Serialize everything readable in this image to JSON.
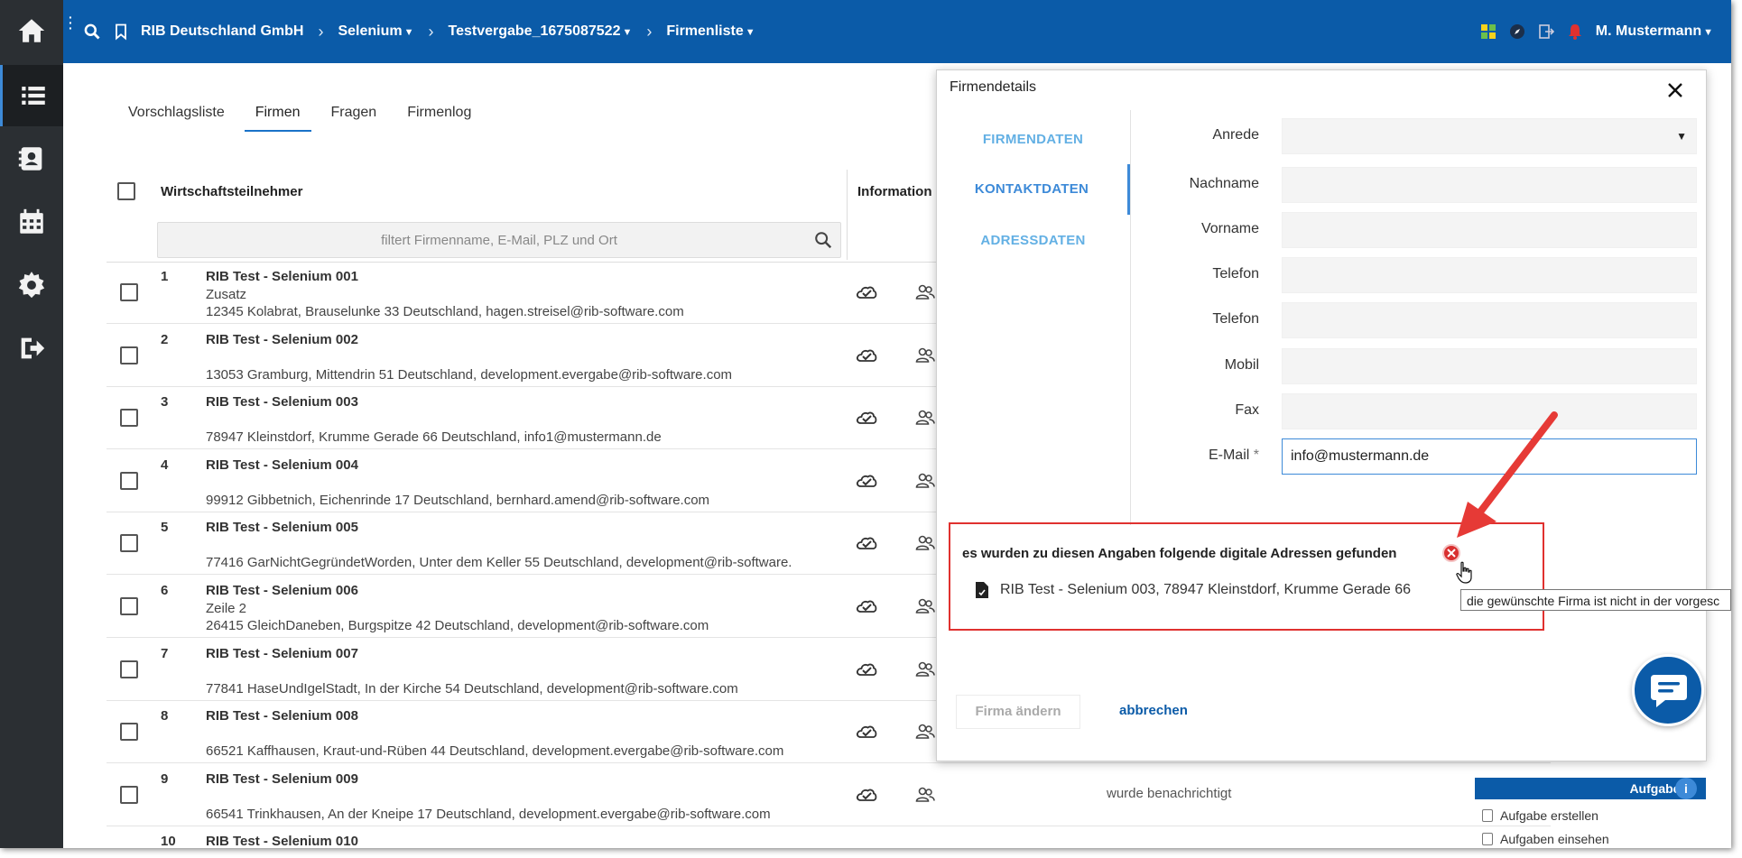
{
  "header": {
    "org": "RIB Deutschland GmbH",
    "crumbs": [
      "Selenium",
      "Testvergabe_1675087522",
      "Firmenliste"
    ],
    "user": "M. Mustermann",
    "colors": {
      "bar": "#0b5ba8",
      "rail": "#2b2f33",
      "accent": "#3d8ad8",
      "alert": "#e0312f"
    }
  },
  "tabs": [
    "Vorschlagsliste",
    "Firmen",
    "Fragen",
    "Firmenlog"
  ],
  "table": {
    "col_company": "Wirtschaftsteilnehmer",
    "col_info": "Information",
    "filter_placeholder": "filtert Firmenname, E-Mail, PLZ und Ort",
    "rows": [
      {
        "num": "1",
        "name": "RIB Test - Selenium 001",
        "extra": "Zusatz",
        "addr": "12345 Kolabrat, Brauselunke 33 Deutschland, hagen.streisel@rib-software.com",
        "status": ""
      },
      {
        "num": "2",
        "name": "RIB Test - Selenium 002",
        "extra": "",
        "addr": "13053 Gramburg, Mittendrin 51 Deutschland, development.evergabe@rib-software.com",
        "status": ""
      },
      {
        "num": "3",
        "name": "RIB Test - Selenium 003",
        "extra": "",
        "addr": "78947 Kleinstdorf, Krumme Gerade 66 Deutschland, info1@mustermann.de",
        "status": ""
      },
      {
        "num": "4",
        "name": "RIB Test - Selenium 004",
        "extra": "",
        "addr": "99912 Gibbetnich, Eichenrinde 17 Deutschland, bernhard.amend@rib-software.com",
        "status": ""
      },
      {
        "num": "5",
        "name": "RIB Test - Selenium 005",
        "extra": "",
        "addr": "77416 GarNichtGegründetWorden, Unter dem Keller 55 Deutschland, development@rib-software.",
        "status": ""
      },
      {
        "num": "6",
        "name": "RIB Test - Selenium 006",
        "extra": "Zeile 2",
        "addr": "26415 GleichDaneben, Burgspitze 42 Deutschland, development@rib-software.com",
        "status": ""
      },
      {
        "num": "7",
        "name": "RIB Test - Selenium 007",
        "extra": "",
        "addr": "77841 HaseUndIgelStadt, In der Kirche 54 Deutschland, development@rib-software.com",
        "status": ""
      },
      {
        "num": "8",
        "name": "RIB Test - Selenium 008",
        "extra": "",
        "addr": "66521 Kaffhausen, Kraut-und-Rüben 44 Deutschland, development.evergabe@rib-software.com",
        "status": ""
      },
      {
        "num": "9",
        "name": "RIB Test - Selenium 009",
        "extra": "",
        "addr": "66541 Trinkhausen, An der Kneipe 17 Deutschland, development.evergabe@rib-software.com",
        "status": "wurde benachrichtigt"
      },
      {
        "num": "10",
        "name": "RIB Test - Selenium 010",
        "extra": "",
        "addr": "",
        "status": ""
      }
    ]
  },
  "tasks": {
    "head": "Aufgaben",
    "items": [
      "Aufgabe erstellen",
      "Aufgaben einsehen"
    ]
  },
  "modal": {
    "title": "Firmendetails",
    "nav": [
      "FIRMENDATEN",
      "KONTAKTDATEN",
      "ADRESSDATEN"
    ],
    "fields": [
      {
        "label": "Anrede",
        "value": "",
        "type": "select"
      },
      {
        "label": "Nachname",
        "value": ""
      },
      {
        "label": "Vorname",
        "value": ""
      },
      {
        "label": "Telefon",
        "value": ""
      },
      {
        "label": "Telefon",
        "value": ""
      },
      {
        "label": "Mobil",
        "value": ""
      },
      {
        "label": "Fax",
        "value": ""
      },
      {
        "label": "E-Mail",
        "required": "*",
        "value": "info@mustermann.de"
      }
    ],
    "found_title": "es wurden zu diesen Angaben folgende digitale Adressen gefunden",
    "found_item": "RIB Test - Selenium 003, 78947 Kleinstdorf, Krumme Gerade 66",
    "tooltip": "die gewünschte Firma ist nicht in der vorgesc",
    "btn_change": "Firma ändern",
    "btn_cancel": "abbrechen"
  }
}
